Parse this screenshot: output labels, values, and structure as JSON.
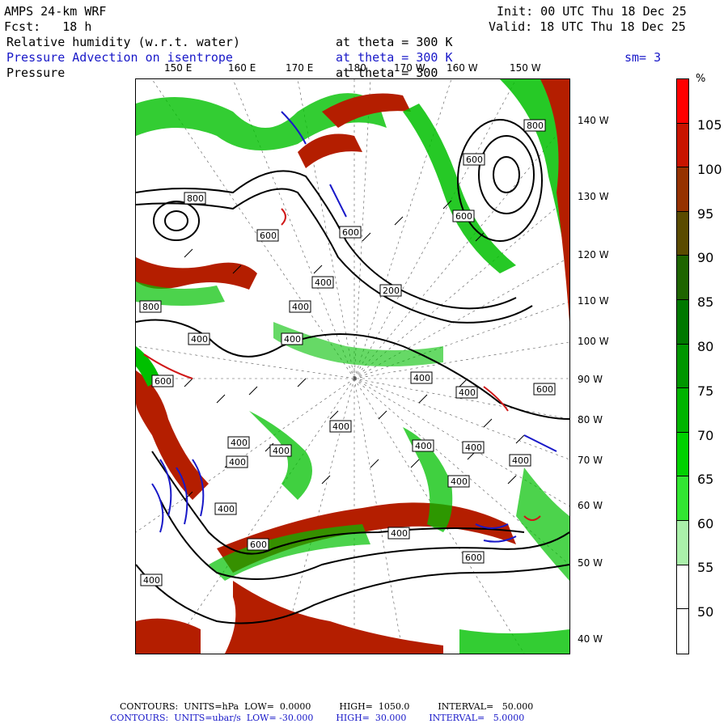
{
  "header": {
    "title": "AMPS 24-km WRF",
    "forecast": "Fcst:   18 h",
    "init": "Init: 00 UTC Thu 18 Dec 25",
    "valid": "Valid: 18 UTC Thu 18 Dec 25"
  },
  "fields": [
    {
      "name": "Relative humidity (w.r.t. water)",
      "level": "at theta = 300 K",
      "color": "#000000"
    },
    {
      "name": "Pressure Advection on isentrope",
      "level": "at theta = 300 K",
      "color": "#1818c8",
      "extra": "sm= 3"
    },
    {
      "name": "Pressure",
      "level": "at theta = 300",
      "color": "#000000"
    }
  ],
  "lon_labels": [
    "150 E",
    "160 E",
    "170 E",
    "180",
    "170 W",
    "160 W",
    "150 W"
  ],
  "lat_labels": [
    "140 W",
    "130 W",
    "120 W",
    "110 W",
    "100 W",
    "90 W",
    "80 W",
    "70 W",
    "60 W",
    "50 W",
    "40 W"
  ],
  "contour_labels": [
    "800",
    "800",
    "600",
    "600",
    "600",
    "600",
    "400",
    "200",
    "400",
    "800",
    "400",
    "400",
    "600",
    "400",
    "400",
    "400",
    "400",
    "400",
    "400",
    "400",
    "400",
    "400",
    "400",
    "400",
    "600",
    "400",
    "600",
    "600",
    "400"
  ],
  "colorbar": {
    "unit": "%",
    "labels": [
      "105",
      "100",
      "95",
      "90",
      "85",
      "80",
      "75",
      "70",
      "65",
      "60",
      "55",
      "50"
    ],
    "colors": [
      "#ff0000",
      "#c81400",
      "#963200",
      "#5a4b00",
      "#1e6400",
      "#007800",
      "#009600",
      "#00b400",
      "#00d200",
      "#32e632",
      "#aaf0aa",
      "#ffffff",
      "#ffffff"
    ]
  },
  "footer": {
    "line1": "CONTOURS:  UNITS=hPa  LOW=  0.0000          HIGH=  1050.0          INTERVAL=   50.000",
    "line2": "CONTOURS:  UNITS=ubar/s  LOW= -30.000        HIGH=  30.000        INTERVAL=   5.0000"
  }
}
